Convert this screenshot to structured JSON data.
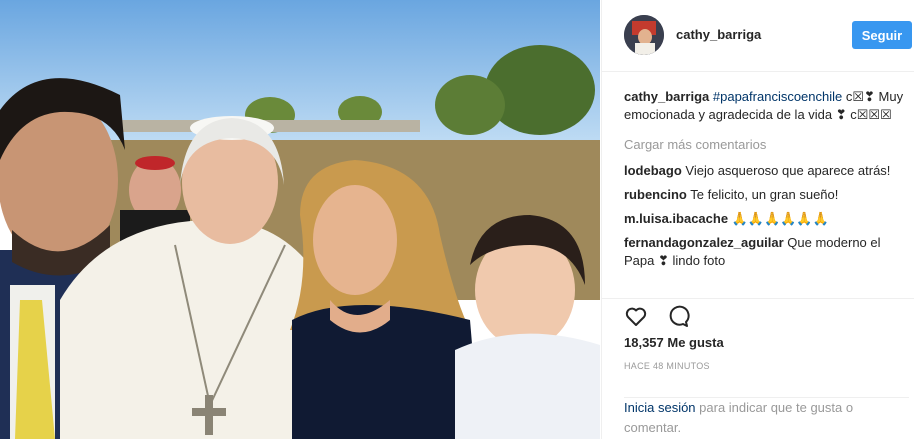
{
  "post": {
    "username": "cathy_barriga",
    "follow_label": "Seguir"
  },
  "caption": {
    "username": "cathy_barriga",
    "hashtag": "#papafranciscoenchile",
    "text": " c☒❣ Muy emocionada y agradecida de la vida ❣ c☒☒☒"
  },
  "load_more": "Cargar más comentarios",
  "comments": [
    {
      "user": "lodebago",
      "text": "Viejo asqueroso que aparece atrás!"
    },
    {
      "user": "rubencino",
      "text": "Te felicito, un gran sueño!"
    },
    {
      "user": "m.luisa.ibacache",
      "text": "🙏🙏🙏🙏🙏🙏"
    },
    {
      "user": "fernandagonzalez_aguilar",
      "text": "Que moderno el Papa ❣ lindo foto"
    }
  ],
  "likes": "18,357 Me gusta",
  "time_ago": "HACE 48 MINUTOS",
  "login": {
    "link": "Inicia sesión",
    "text": " para indicar que te gusta o comentar."
  },
  "icons": [
    "heart-icon",
    "comment-icon"
  ],
  "colors": {
    "accent": "#3897f0",
    "link": "#003569",
    "muted": "#999999"
  }
}
